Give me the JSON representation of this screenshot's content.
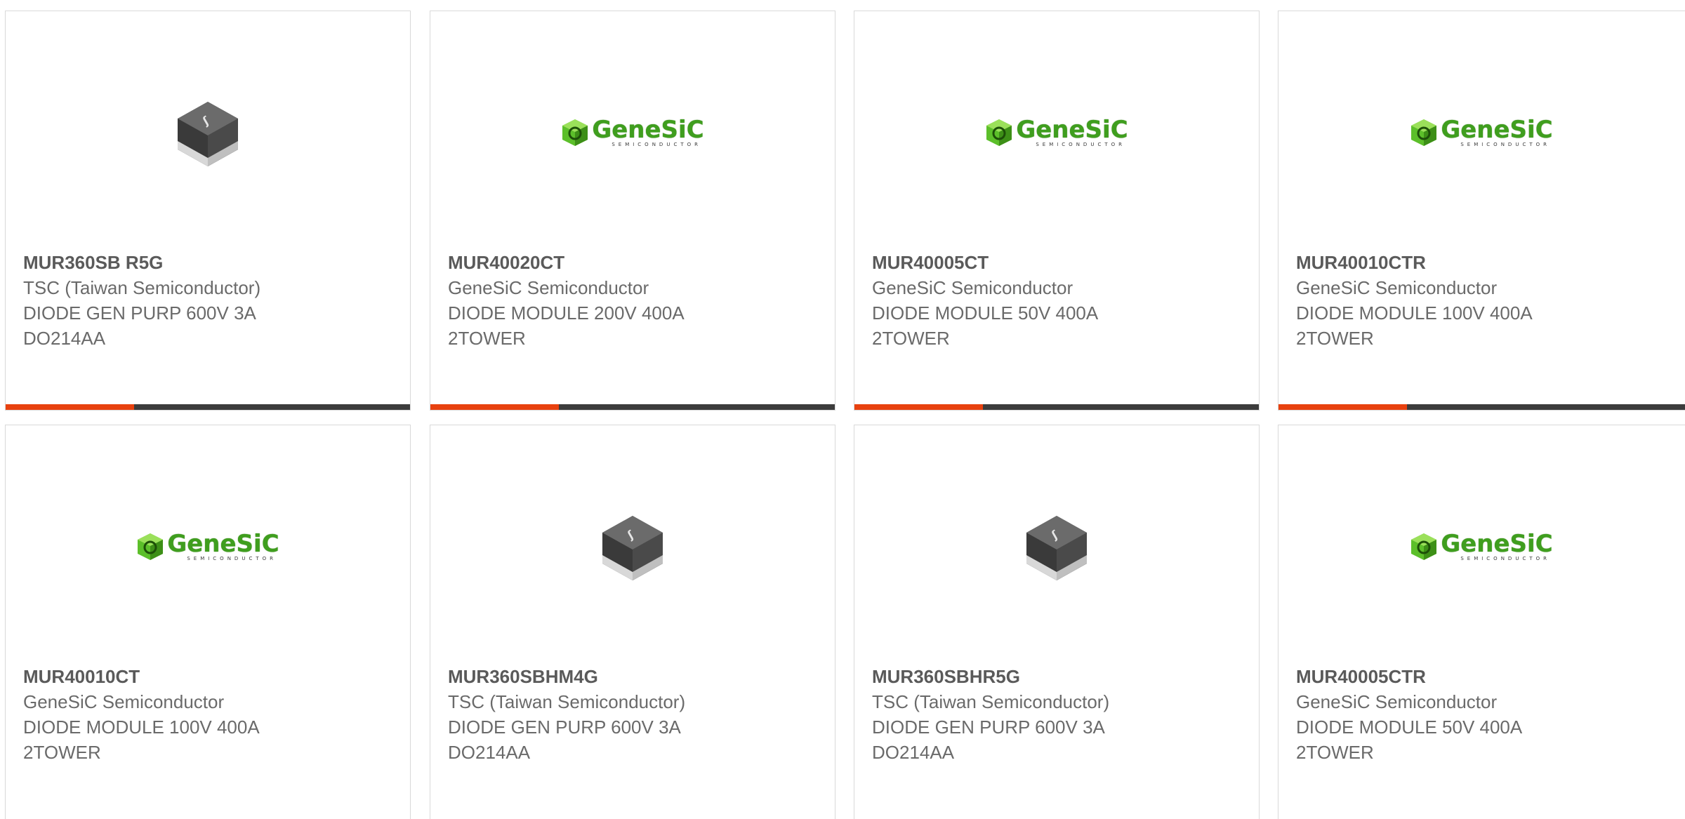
{
  "products": [
    {
      "part_number": "MUR360SB R5G",
      "manufacturer": "TSC (Taiwan Semiconductor)",
      "description_line1": "DIODE GEN PURP 600V 3A",
      "description_line2": "DO214AA",
      "image_icon": "diode-package-icon"
    },
    {
      "part_number": "MUR40020CT",
      "manufacturer": "GeneSiC Semiconductor",
      "description_line1": "DIODE MODULE 200V 400A",
      "description_line2": "2TOWER",
      "image_icon": "genesic-logo",
      "logo_word": "GeneSiC",
      "logo_sub": "SEMICONDUCTOR"
    },
    {
      "part_number": "MUR40005CT",
      "manufacturer": "GeneSiC Semiconductor",
      "description_line1": "DIODE MODULE 50V 400A",
      "description_line2": "2TOWER",
      "image_icon": "genesic-logo",
      "logo_word": "GeneSiC",
      "logo_sub": "SEMICONDUCTOR"
    },
    {
      "part_number": "MUR40010CTR",
      "manufacturer": "GeneSiC Semiconductor",
      "description_line1": "DIODE MODULE 100V 400A",
      "description_line2": "2TOWER",
      "image_icon": "genesic-logo",
      "logo_word": "GeneSiC",
      "logo_sub": "SEMICONDUCTOR"
    },
    {
      "part_number": "MUR40010CT",
      "manufacturer": "GeneSiC Semiconductor",
      "description_line1": "DIODE MODULE 100V 400A",
      "description_line2": "2TOWER",
      "image_icon": "genesic-logo",
      "logo_word": "GeneSiC",
      "logo_sub": "SEMICONDUCTOR"
    },
    {
      "part_number": "MUR360SBHM4G",
      "manufacturer": "TSC (Taiwan Semiconductor)",
      "description_line1": "DIODE GEN PURP 600V 3A",
      "description_line2": "DO214AA",
      "image_icon": "diode-package-icon"
    },
    {
      "part_number": "MUR360SBHR5G",
      "manufacturer": "TSC (Taiwan Semiconductor)",
      "description_line1": "DIODE GEN PURP 600V 3A",
      "description_line2": "DO214AA",
      "image_icon": "diode-package-icon"
    },
    {
      "part_number": "MUR40005CTR",
      "manufacturer": "GeneSiC Semiconductor",
      "description_line1": "DIODE MODULE 50V 400A",
      "description_line2": "2TOWER",
      "image_icon": "genesic-logo",
      "logo_word": "GeneSiC",
      "logo_sub": "SEMICONDUCTOR"
    }
  ],
  "colors": {
    "accent": "#e8410f",
    "bar": "#3c3c3c",
    "logo_green": "#4caf1f"
  }
}
